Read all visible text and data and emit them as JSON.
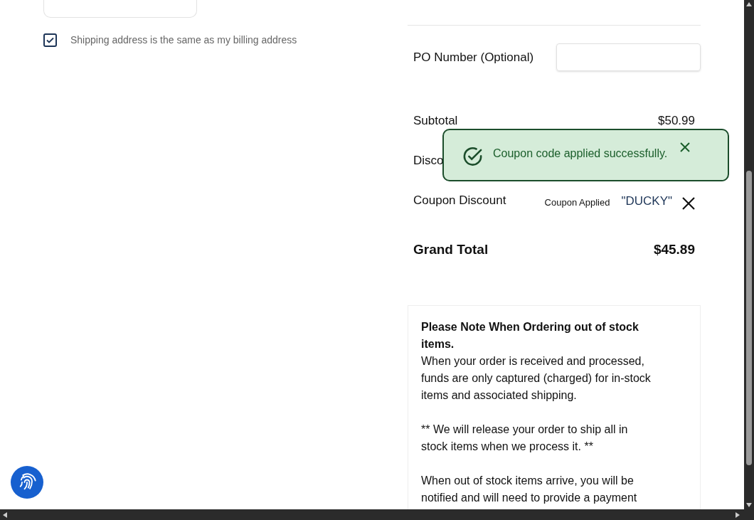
{
  "shipping_same_as_billing": {
    "label": "Shipping address is the same as my billing address",
    "checked": true
  },
  "po_number": {
    "label": "PO Number (Optional)"
  },
  "summary": [
    {
      "kind": "amount",
      "label": "Subtotal",
      "value": "$50.99"
    },
    {
      "kind": "label_only",
      "label": "Disco"
    },
    {
      "kind": "coupon",
      "label": "Coupon Discount",
      "status": "Coupon Applied",
      "code": "\"DUCKY\""
    }
  ],
  "grand_total": {
    "label": "Grand Total",
    "value": "$45.89"
  },
  "note": {
    "title": "Please Note When Ordering out of stock items.",
    "paragraphs": [
      "When your order is received and processed, funds are only captured (charged) for in-stock items and associated shipping.",
      "** We will release your order to ship all in stock items when we process it. **",
      "When out of stock items arrive, you will be notified and will need to provide a payment"
    ]
  },
  "toast": {
    "message": "Coupon code applied successfully."
  }
}
